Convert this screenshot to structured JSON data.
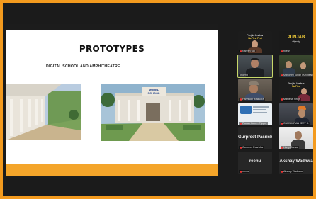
{
  "slide": {
    "title": "PROTOTYPES",
    "subtitle": "DIGITAL SCHOOL AND AMPHITHEATRE",
    "building_sign": "MODEL SCHOOL"
  },
  "participants": [
    {
      "name": "Naresh Gill",
      "banner_line1": "Punjabi Amritsar",
      "banner_line2": "Na First",
      "banner_line3": "Fest"
    },
    {
      "name": "nilesh",
      "logo_line1": "PUNJAB",
      "logo_line2": "dignity"
    },
    {
      "name": "Inderjit",
      "active": true
    },
    {
      "name": "Mandeep Singh (Amritsar)",
      "banner_line1": "Punjabi Amritsar",
      "banner_line2": "Na First",
      "banner_line3": "Fest"
    },
    {
      "name": "Harvinder Malhotra"
    },
    {
      "name": "Manisha Singh",
      "banner_line1": "Punjabi Amritsar",
      "banner_line2": "Na First"
    },
    {
      "name": "Pawan Kalra - Flipper"
    },
    {
      "name": "GURSIMRAN JEET S."
    },
    {
      "name": "Gurpreet Pasricha",
      "display_name": "Gurpreet Pasricha"
    },
    {
      "name": "Harry Grewal"
    },
    {
      "name": "reenu",
      "display_name": "reenu"
    },
    {
      "name": "Akshay Wadhwa",
      "display_name": "Akshay Wadhwa"
    }
  ],
  "colors": {
    "accent_border": "#f39a1e",
    "slide_band": "#f4a52a",
    "active_speaker": "#c8d86a"
  }
}
